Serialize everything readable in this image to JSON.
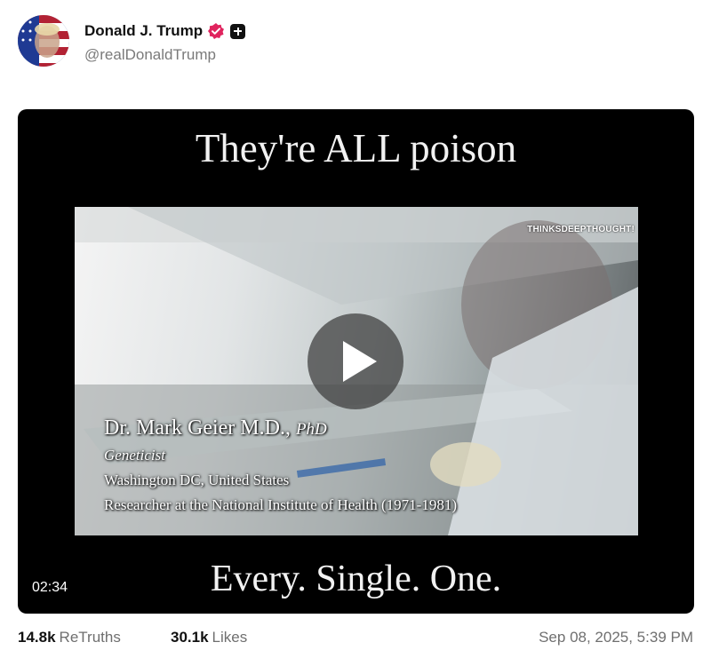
{
  "author": {
    "display_name": "Donald J. Trump",
    "handle": "@realDonaldTrump",
    "verified_color": "#e0245e"
  },
  "video": {
    "caption_top": "They're ALL poison",
    "caption_bottom": "Every. Single. One.",
    "watermark": "THINKSDEEPTHOUGHT!",
    "lower_third": {
      "name": "Dr. Mark Geier M.D.,",
      "credentials": "PhD",
      "title": "Geneticist",
      "location": "Washington DC, United States",
      "role": "Researcher at the National Institute of Health (1971-1981)"
    },
    "duration": "02:34",
    "play_icon": "play-icon"
  },
  "stats": {
    "retruths_count": "14.8k",
    "retruths_label": "ReTruths",
    "likes_count": "30.1k",
    "likes_label": "Likes"
  },
  "timestamp": "Sep 08, 2025, 5:39 PM"
}
